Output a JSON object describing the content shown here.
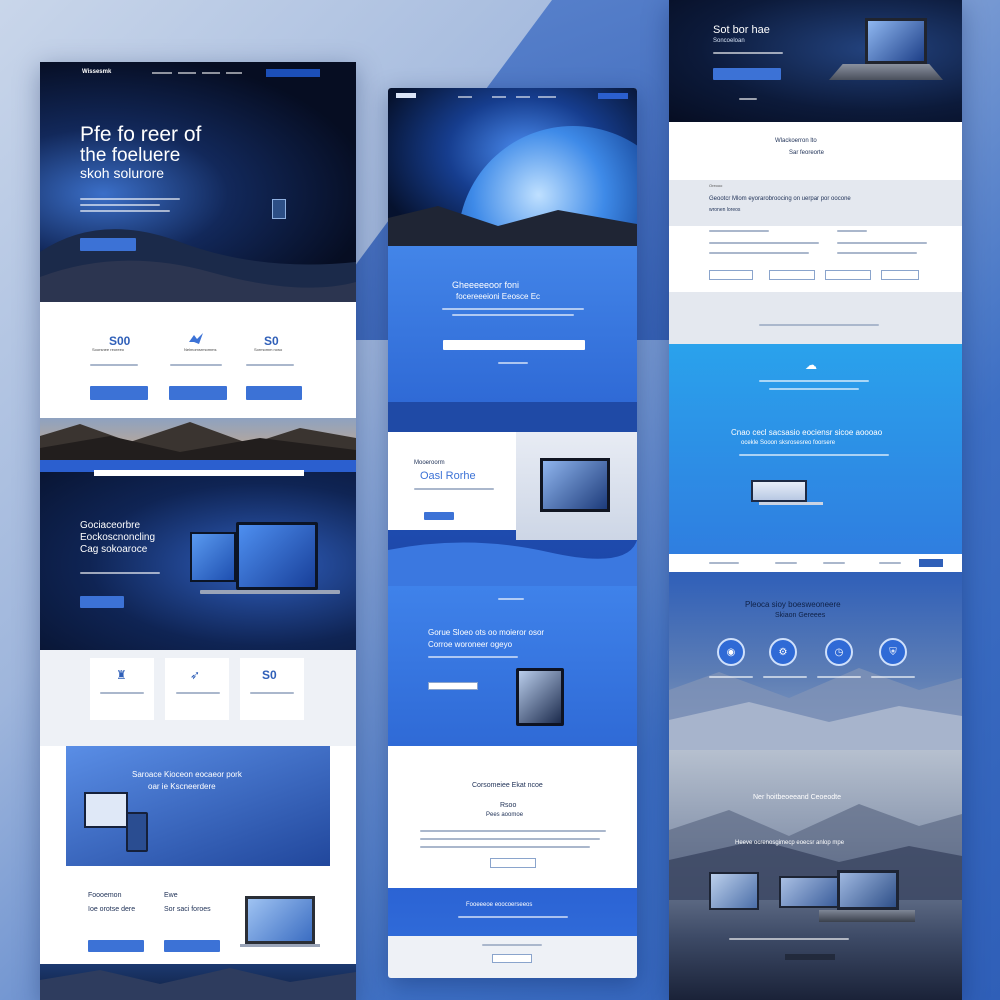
{
  "col1": {
    "logo": "Wissesmk",
    "hero_title_1": "Pfe fo reer of",
    "hero_title_2": "the foeluere",
    "hero_title_3": "skoh solurore",
    "stats": [
      {
        "value": "S00",
        "label": "Soorsnee reoreeo"
      },
      {
        "value": "",
        "label": "Nelmomsrmomms"
      },
      {
        "value": "S0",
        "label": "Sormomm rowo"
      }
    ],
    "band_title_1": "Gociaceorbre",
    "band_title_2": "Eockoscnoncling",
    "band_title_3": "Cag sokoaroce",
    "icon_value": "S0",
    "promo_title_1": "Saroace Kioceon eocaeor pork",
    "promo_title_2": "oar ie Kscneerdere",
    "footer_h1": "Foooemon",
    "footer_h2": "Ewe",
    "footer_sub1": "Ioe orotse dere",
    "footer_sub2": "Sor saci foroes"
  },
  "col2": {
    "blue_title_1": "Gheeeeeoor foni",
    "blue_title_2": "focereeeioni Eeosce Ec",
    "feature_title_1": "Mooeroorm",
    "feature_title_2": "Oasl Rorhe",
    "promo_title_1": "Gorue Sloeo ots oo moieror osor",
    "promo_title_2": "Corroe woroneer ogeyo",
    "section_title": "Corsomeiee Ekat ncoe",
    "sub_title": "Rsoo",
    "sub_title_2": "Pees aoomoe",
    "footer_band": "Fooeeeoe eoocoerseeos"
  },
  "col3": {
    "top_title": "Sot bor hae",
    "top_sub": "Soncoeloan",
    "white_title_1": "Wlackoerron lto",
    "white_title_2": "Sar feoreorte",
    "gray_label": "Oreooo",
    "gray_title_1": "Geootcr Mlom eyorarobroocing on uerpar por oocone",
    "gray_title_2": "wronen loreos",
    "cyan_title_1": "Cnao cecl sacsasio eociensr sicoe aoooao",
    "cyan_title_2": "ocekle Sooon sksrosesreo foorsere",
    "mountain_title_1": "Pleoca sioy boesweoneere",
    "mountain_title_2": "Skiaon Gereees",
    "dusk_title": "Ner hoitbeoeeand Ceoeodte",
    "dusk_title_2": "Heeve ocrenosgimecp eoecsr anlop mpe"
  },
  "colors": {
    "primary": "#3c72d6",
    "navy": "#0d1c3d",
    "cyan": "#2e9ce8"
  }
}
